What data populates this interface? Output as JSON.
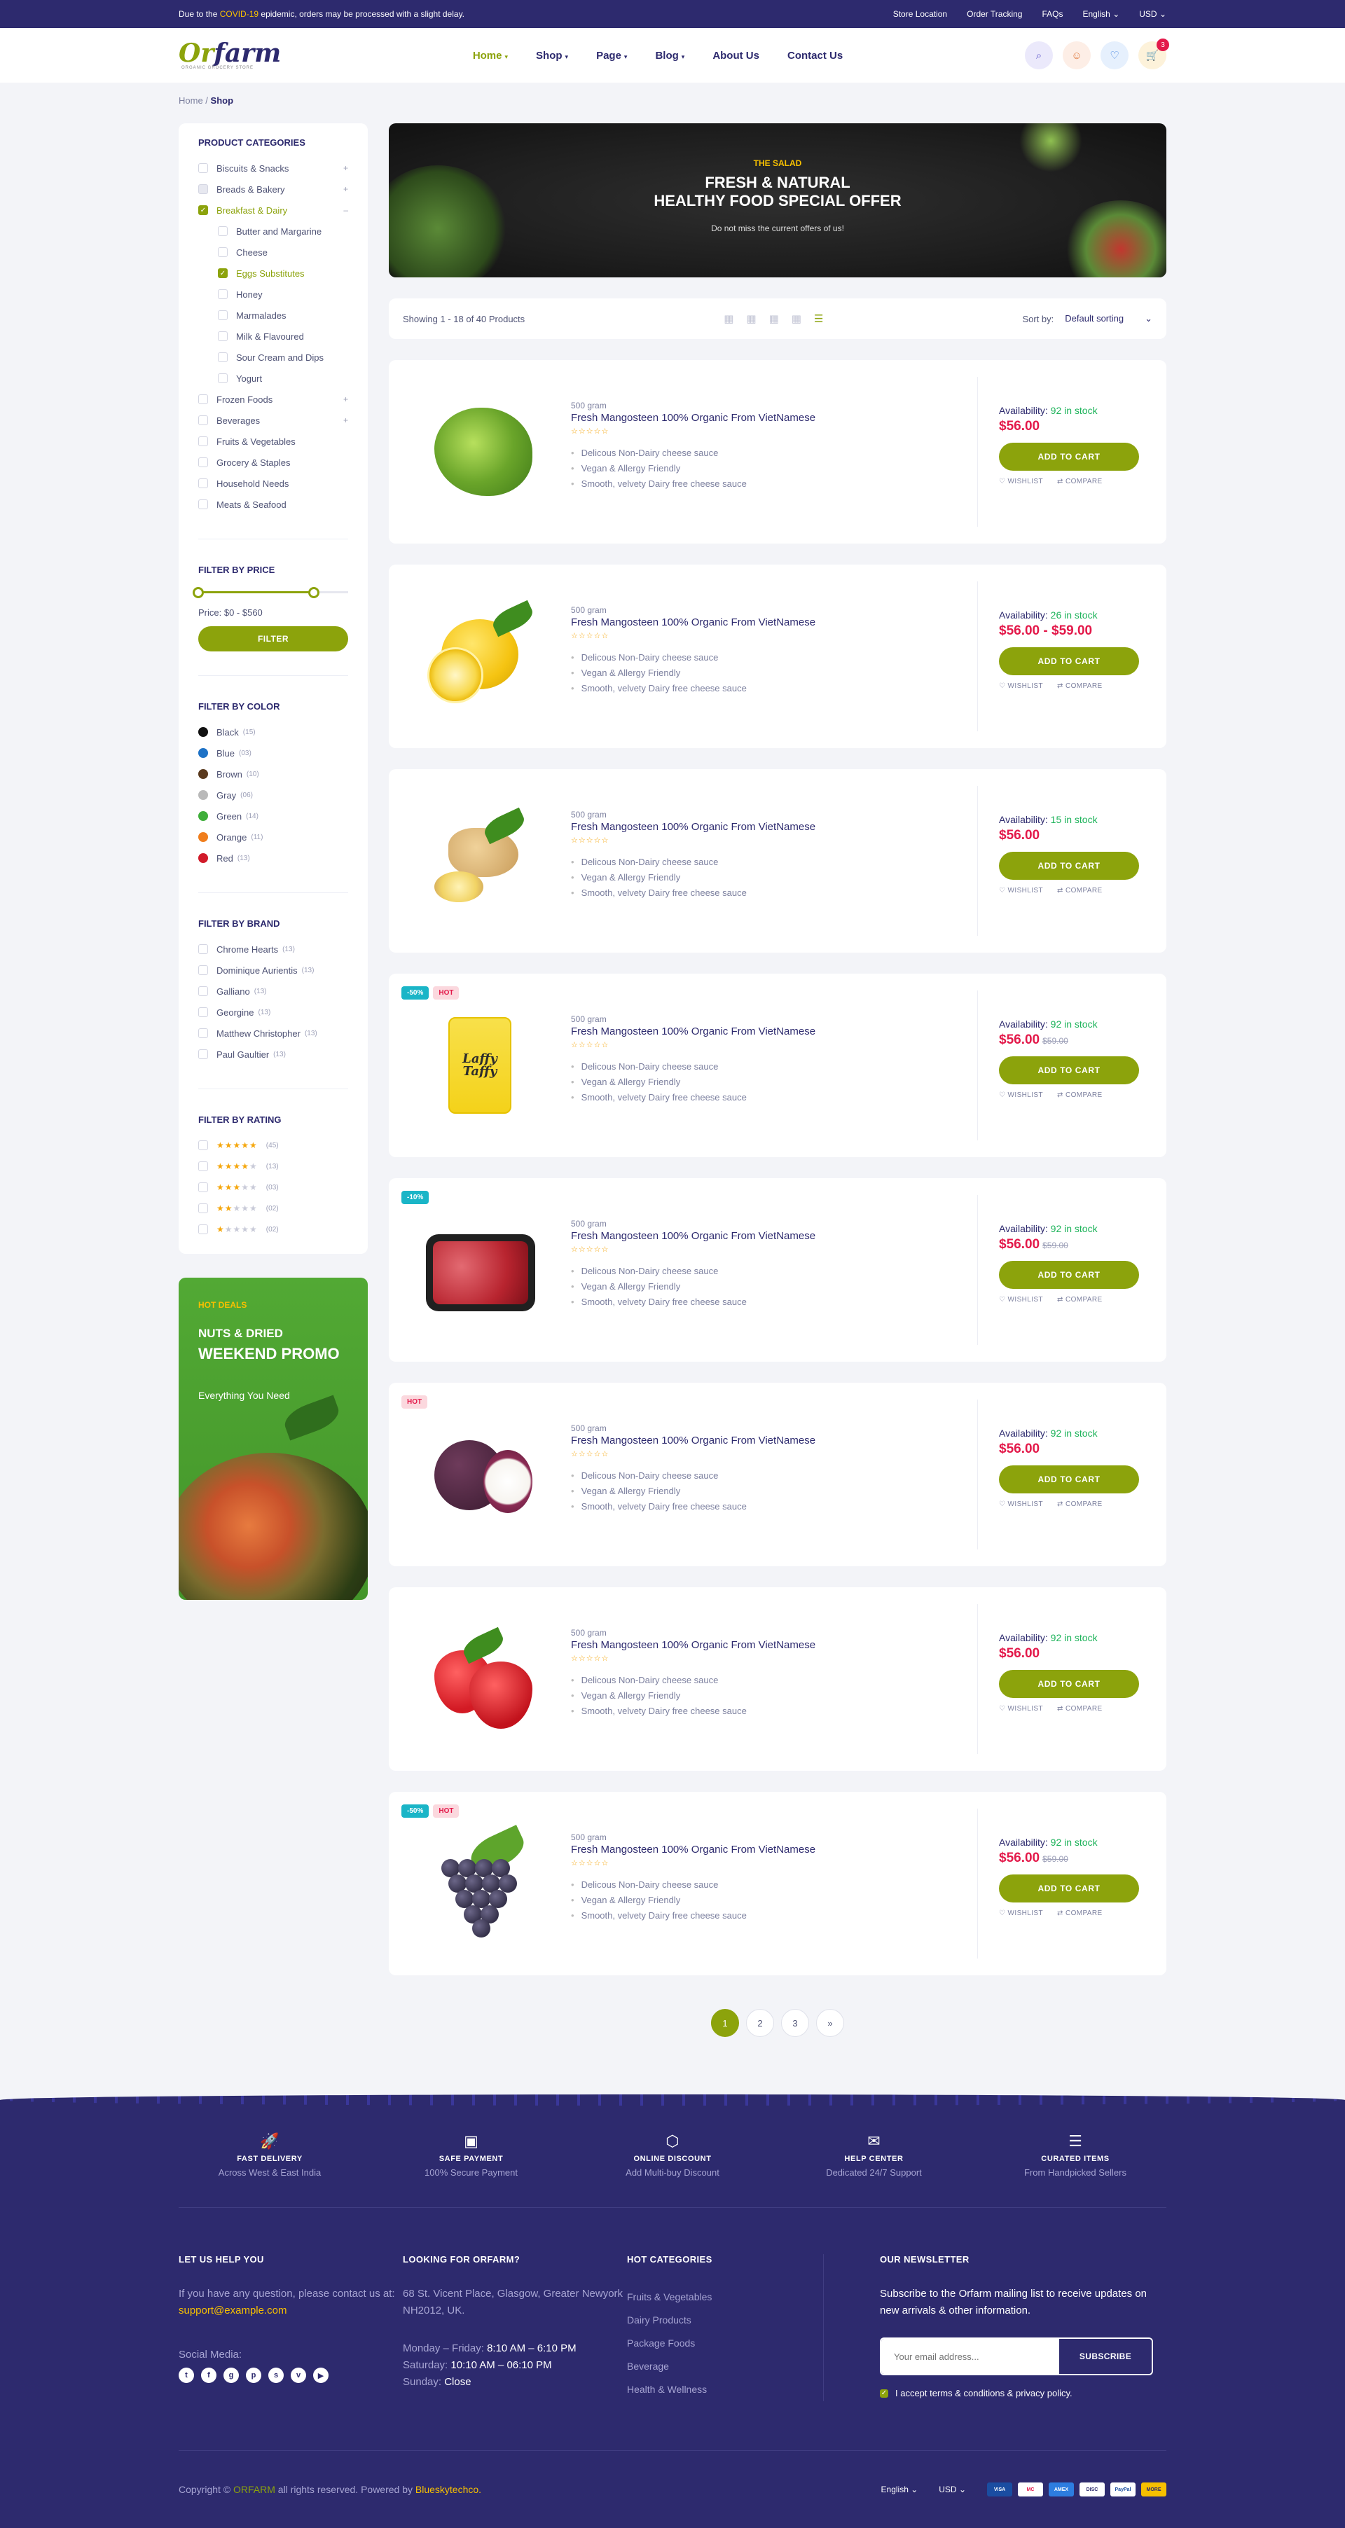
{
  "topbar": {
    "notice_pre": "Due to the",
    "notice_hl": "COVID-19",
    "notice_post": "epidemic, orders may be processed with a slight delay.",
    "links": [
      "Store Location",
      "Order Tracking",
      "FAQs",
      "English",
      "USD"
    ]
  },
  "logo": {
    "name_a": "Or",
    "name_b": "farm",
    "tagline": "ORGANIC GROCERY STORE"
  },
  "nav": [
    "Home",
    "Shop",
    "Page",
    "Blog",
    "About Us",
    "Contact Us"
  ],
  "cart_count": "3",
  "breadcrumb": {
    "home": "Home",
    "current": "Shop"
  },
  "categories": {
    "title": "PRODUCT CATEGORIES",
    "items": [
      {
        "label": "Biscuits & Snacks",
        "expand": "+"
      },
      {
        "label": "Breads & Bakery",
        "expand": "+"
      },
      {
        "label": "Breakfast & Dairy",
        "expand": "–"
      },
      {
        "label": "Butter and Margarine"
      },
      {
        "label": "Cheese"
      },
      {
        "label": "Eggs Substitutes"
      },
      {
        "label": "Honey"
      },
      {
        "label": "Marmalades"
      },
      {
        "label": "Milk & Flavoured"
      },
      {
        "label": "Sour Cream and Dips"
      },
      {
        "label": "Yogurt"
      },
      {
        "label": "Frozen Foods",
        "expand": "+"
      },
      {
        "label": "Beverages",
        "expand": "+"
      },
      {
        "label": "Fruits & Vegetables"
      },
      {
        "label": "Grocery & Staples"
      },
      {
        "label": "Household Needs"
      },
      {
        "label": "Meats & Seafood"
      }
    ]
  },
  "price_filter": {
    "title": "FILTER BY PRICE",
    "label": "Price: $0 - $560",
    "button": "FILTER",
    "min_fraction": 0.0,
    "max_fraction": 0.77
  },
  "color_filter": {
    "title": "FILTER BY COLOR",
    "items": [
      {
        "label": "Black",
        "count": "(15)",
        "hex": "#111111"
      },
      {
        "label": "Blue",
        "count": "(03)",
        "hex": "#1e72c6"
      },
      {
        "label": "Brown",
        "count": "(10)",
        "hex": "#5a3a1e"
      },
      {
        "label": "Gray",
        "count": "(06)",
        "hex": "#b9b9b9"
      },
      {
        "label": "Green",
        "count": "(14)",
        "hex": "#3fae3a"
      },
      {
        "label": "Orange",
        "count": "(11)",
        "hex": "#f07e1d"
      },
      {
        "label": "Red",
        "count": "(13)",
        "hex": "#d11b2a"
      }
    ]
  },
  "brand_filter": {
    "title": "FILTER BY BRAND",
    "items": [
      {
        "label": "Chrome Hearts",
        "count": "(13)"
      },
      {
        "label": "Dominique Aurientis",
        "count": "(13)"
      },
      {
        "label": "Galliano",
        "count": "(13)"
      },
      {
        "label": "Georgine",
        "count": "(13)"
      },
      {
        "label": "Matthew Christopher",
        "count": "(13)"
      },
      {
        "label": "Paul Gaultier",
        "count": "(13)"
      }
    ]
  },
  "rating_filter": {
    "title": "FILTER BY RATING",
    "items": [
      {
        "stars": 5,
        "count": "(45)"
      },
      {
        "stars": 4,
        "count": "(13)"
      },
      {
        "stars": 3,
        "count": "(03)"
      },
      {
        "stars": 2,
        "count": "(02)"
      },
      {
        "stars": 1,
        "count": "(02)"
      }
    ]
  },
  "promo": {
    "kicker": "HOT DEALS",
    "line1": "NUTS & DRIED",
    "line2": "WEEKEND PROMO",
    "line3": "Everything You Need"
  },
  "banner": {
    "kicker": "THE SALAD",
    "line1": "FRESH & NATURAL",
    "line2": "HEALTHY FOOD SPECIAL OFFER",
    "sub": "Do not miss the current offers of us!"
  },
  "toolbar": {
    "showing": "Showing 1 - 18 of 40 Products",
    "sort_label": "Sort by:",
    "sort_value": "Default sorting"
  },
  "products": [
    {
      "weight": "500 gram",
      "name": "Fresh Mangosteen 100% Organic From VietNamese",
      "stock": "92 in stock",
      "price": "$56.00",
      "old_price": "",
      "badges": [],
      "pic": "lettuce"
    },
    {
      "weight": "500 gram",
      "name": "Fresh Mangosteen 100% Organic From VietNamese",
      "stock": "26 in stock",
      "price": "$56.00 - $59.00",
      "old_price": "",
      "badges": [],
      "pic": "lemon"
    },
    {
      "weight": "500 gram",
      "name": "Fresh Mangosteen 100% Organic From VietNamese",
      "stock": "15 in stock",
      "price": "$56.00",
      "old_price": "",
      "badges": [],
      "pic": "ginger"
    },
    {
      "weight": "500 gram",
      "name": "Fresh Mangosteen 100% Organic From VietNamese",
      "stock": "92 in stock",
      "price": "$56.00",
      "old_price": "$59.00",
      "badges": [
        {
          "text": "-50%",
          "type": "off"
        },
        {
          "text": "HOT",
          "type": "hot"
        }
      ],
      "pic": "candy"
    },
    {
      "weight": "500 gram",
      "name": "Fresh Mangosteen 100% Organic From VietNamese",
      "stock": "92 in stock",
      "price": "$56.00",
      "old_price": "$59.00",
      "badges": [
        {
          "text": "-10%",
          "type": "off"
        }
      ],
      "pic": "meat"
    },
    {
      "weight": "500 gram",
      "name": "Fresh Mangosteen 100% Organic From VietNamese",
      "stock": "92 in stock",
      "price": "$56.00",
      "old_price": "",
      "badges": [
        {
          "text": "HOT",
          "type": "hot"
        }
      ],
      "pic": "mango"
    },
    {
      "weight": "500 gram",
      "name": "Fresh Mangosteen 100% Organic From VietNamese",
      "stock": "92 in stock",
      "price": "$56.00",
      "old_price": "",
      "badges": [],
      "pic": "straw"
    },
    {
      "weight": "500 gram",
      "name": "Fresh Mangosteen 100% Organic From VietNamese",
      "stock": "92 in stock",
      "price": "$56.00",
      "old_price": "$59.00",
      "badges": [
        {
          "text": "-50%",
          "type": "off"
        },
        {
          "text": "HOT",
          "type": "hot"
        }
      ],
      "pic": "grape"
    }
  ],
  "product_common": {
    "features": [
      "Delicous Non-Dairy cheese sauce",
      "Vegan & Allergy Friendly",
      "Smooth, velvety Dairy free cheese sauce"
    ],
    "availability_label": "Availability:",
    "cart_button": "ADD TO CART",
    "wishlist": "WISHLIST",
    "compare": "COMPARE",
    "rating_stars": "☆☆☆☆☆"
  },
  "pagination": [
    "1",
    "2",
    "3",
    "»"
  ],
  "features": [
    {
      "title": "FAST DELIVERY",
      "sub": "Across West & East India",
      "icon": "rocket-icon",
      "glyph": "🚀"
    },
    {
      "title": "SAFE PAYMENT",
      "sub": "100% Secure Payment",
      "icon": "wallet-icon",
      "glyph": "▣"
    },
    {
      "title": "ONLINE DISCOUNT",
      "sub": "Add Multi-buy Discount",
      "icon": "discount-icon",
      "glyph": "⬡"
    },
    {
      "title": "HELP CENTER",
      "sub": "Dedicated 24/7 Support",
      "icon": "chat-icon",
      "glyph": "✉"
    },
    {
      "title": "CURATED ITEMS",
      "sub": "From Handpicked Sellers",
      "icon": "list-icon",
      "glyph": "☰"
    }
  ],
  "footer": {
    "help_title": "LET US HELP YOU",
    "help_text": "If you have any question, please contact us at:",
    "help_email": "support@example.com",
    "social_label": "Social Media:",
    "looking_title": "LOOKING FOR ORFARM?",
    "address": "68 St. Vicent Place, Glasgow, Greater Newyork NH2012, UK.",
    "hours": [
      {
        "day": "Monday – Friday:",
        "time": "8:10 AM – 6:10 PM"
      },
      {
        "day": "Saturday:",
        "time": "10:10 AM – 06:10 PM"
      },
      {
        "day": "Sunday:",
        "time": "Close"
      }
    ],
    "hot_title": "HOT CATEGORIES",
    "hot_items": [
      "Fruits & Vegetables",
      "Dairy Products",
      "Package Foods",
      "Beverage",
      "Health & Wellness"
    ],
    "nl_title": "OUR NEWSLETTER",
    "nl_text": "Subscribe to the Orfarm mailing list to receive updates on new arrivals & other information.",
    "nl_placeholder": "Your email address...",
    "nl_button": "SUBSCRIBE",
    "nl_terms": "I accept terms & conditions & privacy policy."
  },
  "copyright": {
    "pre": "Copyright ©",
    "brand": "ORFARM",
    "mid": "all rights reserved. Powered by",
    "by": "Blueskytechco.",
    "lang": "English",
    "currency": "USD",
    "cards": [
      "VISA",
      "MC",
      "AMEX",
      "DISC",
      "PayPal",
      "MORE"
    ]
  }
}
